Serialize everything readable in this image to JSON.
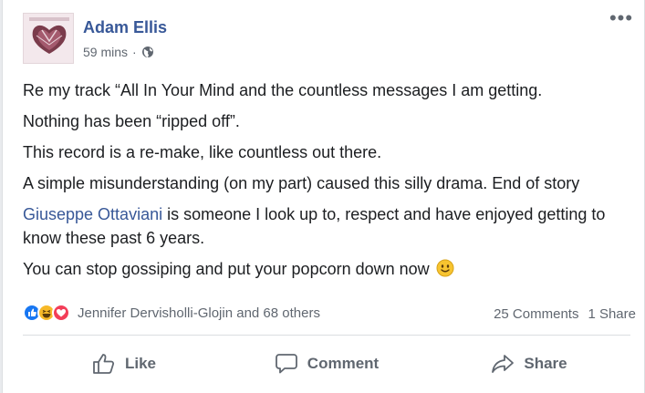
{
  "post": {
    "author": "Adam Ellis",
    "time": "59 mins",
    "separator": "·",
    "more_label": "•••",
    "privacy_icon": "globe-icon",
    "paragraphs": [
      "Re my track “All In Your Mind and the countless messages I am getting.",
      "Nothing has been “ripped off”.",
      "This record is a re-make, like countless out there.",
      "A simple misunderstanding (on my part) caused this silly drama. End of story"
    ],
    "mention": "Giuseppe Ottaviani",
    "mention_rest": " is someone I look up to, respect and have enjoyed getting to know these past 6 years.",
    "last_paragraph": "You can stop gossiping and put your popcorn down now",
    "last_emoji": "slightly-smiling-face-emoji"
  },
  "stats": {
    "reaction_icons": [
      "like-reaction-icon",
      "haha-reaction-icon",
      "love-reaction-icon"
    ],
    "reactors": "Jennifer Dervisholli-Glojin and 68 others",
    "comments": "25 Comments",
    "shares": "1 Share"
  },
  "actions": {
    "like": "Like",
    "comment": "Comment",
    "share": "Share"
  },
  "colors": {
    "link": "#385898",
    "text": "#1c1e21",
    "secondary": "#606770",
    "like_blue": "#1877f2",
    "love_red": "#f33e58",
    "haha_yellow": "#f7b928"
  }
}
